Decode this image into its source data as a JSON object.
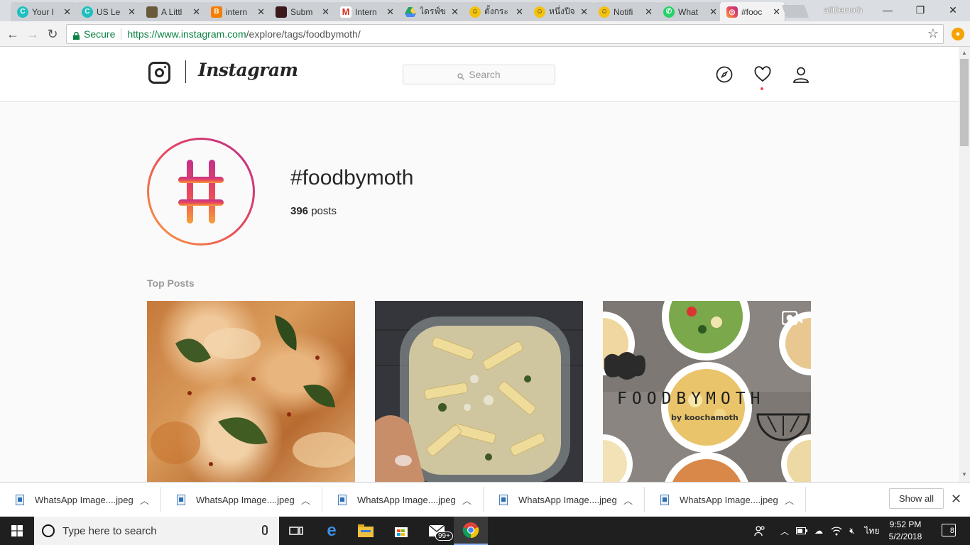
{
  "browser": {
    "tabs": [
      {
        "title": "Your I",
        "favicon": "c-circle-icon",
        "color": "#1ebfbf"
      },
      {
        "title": "US Le",
        "favicon": "c-circle-icon",
        "color": "#1ebfbf"
      },
      {
        "title": "A Littl",
        "favicon": "image-icon",
        "color": "#6a5a3a"
      },
      {
        "title": "intern",
        "favicon": "blogger-icon",
        "color": "#f57d00"
      },
      {
        "title": "Subm",
        "favicon": "square-red-icon",
        "color": "#3a1a1a"
      },
      {
        "title": "Intern",
        "favicon": "gmail-icon",
        "color": "#d93025"
      },
      {
        "title": "ไดรฟ์ข",
        "favicon": "drive-icon",
        "color": "#1fa463"
      },
      {
        "title": "ตั้งกระ",
        "favicon": "pantip-icon",
        "color": "#f4c20d"
      },
      {
        "title": "หนึ่งปีจ",
        "favicon": "pantip-icon",
        "color": "#f4c20d"
      },
      {
        "title": "Notifi",
        "favicon": "pantip-icon",
        "color": "#f4c20d"
      },
      {
        "title": "What",
        "favicon": "whatsapp-icon",
        "color": "#25d366"
      },
      {
        "title": "#fooc",
        "favicon": "instagram-icon",
        "color": "#c13584"
      }
    ],
    "profile_name": "alittlemoth",
    "address": {
      "secure_label": "Secure",
      "url_host": "https://www.instagram.com",
      "url_path": "/explore/tags/foodbymoth/"
    }
  },
  "instagram": {
    "wordmark": "Instagram",
    "search_placeholder": "Search",
    "hashtag": {
      "title": "#foodbymoth",
      "post_count": "396",
      "post_count_label": "posts"
    },
    "section_label": "Top Posts",
    "posts": [
      {
        "name": "post-chicken-spinach",
        "is_video": false
      },
      {
        "name": "post-penne-pasta",
        "is_video": false
      },
      {
        "name": "post-foodbymoth-collage",
        "is_video": true,
        "overlay_title": "FOODBYMOTH",
        "overlay_subtitle": "by koochamoth"
      }
    ]
  },
  "downloads": {
    "items": [
      {
        "filename": "WhatsApp Image....jpeg"
      },
      {
        "filename": "WhatsApp Image....jpeg"
      },
      {
        "filename": "WhatsApp Image....jpeg"
      },
      {
        "filename": "WhatsApp Image....jpeg"
      },
      {
        "filename": "WhatsApp Image....jpeg"
      }
    ],
    "show_all_label": "Show all"
  },
  "taskbar": {
    "search_placeholder": "Type here to search",
    "mail_badge": "99+",
    "input_language": "ไทย",
    "time": "9:52 PM",
    "date": "5/2/2018",
    "notification_count": "8"
  }
}
